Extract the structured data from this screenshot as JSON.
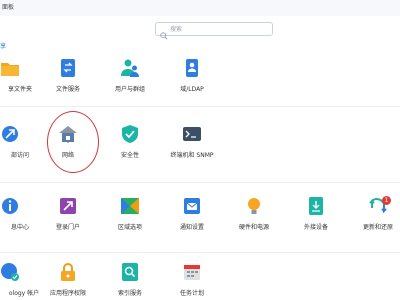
{
  "window": {
    "title": "面板"
  },
  "search": {
    "placeholder": "搜索"
  },
  "section": {
    "title": "享"
  },
  "items": {
    "r1": [
      {
        "label": "享文件夹",
        "icon": "folder-share-icon"
      },
      {
        "label": "文件服务",
        "icon": "file-services-icon"
      },
      {
        "label": "用户与群组",
        "icon": "users-groups-icon"
      },
      {
        "label": "域/LDAP",
        "icon": "domain-ldap-icon"
      }
    ],
    "r2": [
      {
        "label": "部访问",
        "icon": "external-access-icon"
      },
      {
        "label": "网络",
        "icon": "network-icon"
      },
      {
        "label": "安全性",
        "icon": "security-icon"
      },
      {
        "label": "终端机和 SNMP",
        "icon": "terminal-snmp-icon"
      }
    ],
    "r3": [
      {
        "label": "息中心",
        "icon": "info-center-icon"
      },
      {
        "label": "登录门户",
        "icon": "login-portal-icon"
      },
      {
        "label": "区域选项",
        "icon": "regional-options-icon"
      },
      {
        "label": "通知设置",
        "icon": "notification-icon"
      },
      {
        "label": "硬件和电源",
        "icon": "hardware-power-icon"
      },
      {
        "label": "外接设备",
        "icon": "external-devices-icon"
      },
      {
        "label": "更新和还原",
        "icon": "update-restore-icon",
        "badge": "1"
      }
    ],
    "r4": [
      {
        "label": "ology 帐户",
        "icon": "account-icon"
      },
      {
        "label": "应用程序权限",
        "icon": "app-privileges-icon"
      },
      {
        "label": "索引服务",
        "icon": "indexing-icon"
      },
      {
        "label": "任务计划",
        "icon": "task-scheduler-icon"
      }
    ]
  },
  "colors": {
    "accent": "#2c7be5",
    "highlight": "#d0393a"
  }
}
